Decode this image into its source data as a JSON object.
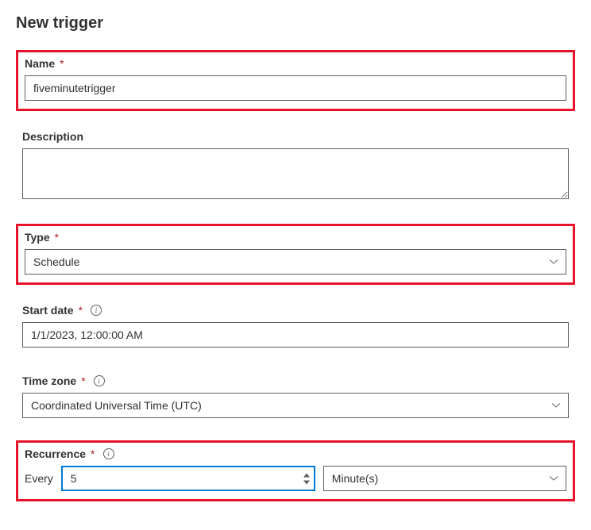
{
  "title": "New trigger",
  "fields": {
    "name": {
      "label": "Name",
      "value": "fiveminutetrigger"
    },
    "description": {
      "label": "Description",
      "value": ""
    },
    "type": {
      "label": "Type",
      "value": "Schedule"
    },
    "start_date": {
      "label": "Start date",
      "value": "1/1/2023, 12:00:00 AM"
    },
    "time_zone": {
      "label": "Time zone",
      "value": "Coordinated Universal Time (UTC)"
    },
    "recurrence": {
      "label": "Recurrence",
      "every_label": "Every",
      "interval": "5",
      "unit": "Minute(s)"
    }
  }
}
